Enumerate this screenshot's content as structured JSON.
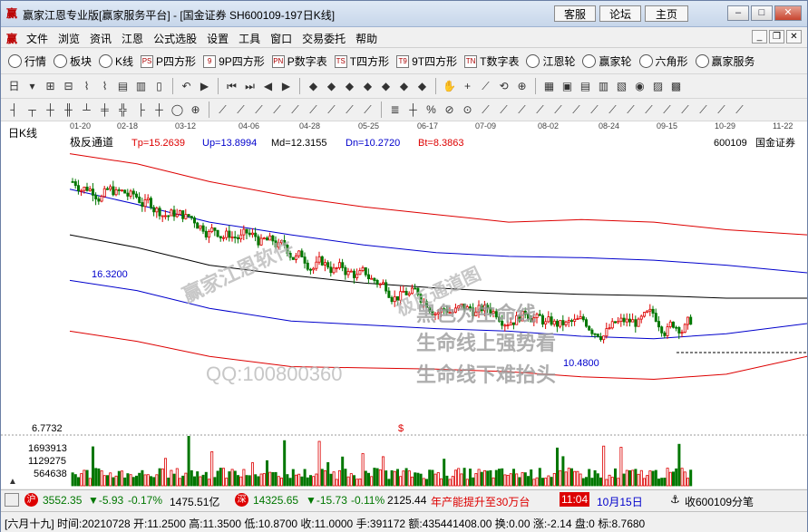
{
  "window": {
    "title": "赢家江恩专业版[赢家服务平台] - [国金证券  SH600109-197日K线]",
    "app_icon": "赢",
    "buttons": [
      "客服",
      "论坛",
      "主页"
    ]
  },
  "menu": {
    "items": [
      "文件",
      "浏览",
      "资讯",
      "江恩",
      "公式选股",
      "设置",
      "工具",
      "窗口",
      "交易委托",
      "帮助"
    ]
  },
  "toolbar1": {
    "items": [
      {
        "label": "行情",
        "icon": "grid-icon"
      },
      {
        "label": "板块",
        "icon": "blocks-icon"
      },
      {
        "label": "K线",
        "icon": "candlestick-icon"
      },
      {
        "label": "P四方形",
        "icon": "PS"
      },
      {
        "label": "9P四方形",
        "icon": "9"
      },
      {
        "label": "P数字表",
        "icon": "PN"
      },
      {
        "label": "T四方形",
        "icon": "TS"
      },
      {
        "label": "9T四方形",
        "icon": "T9"
      },
      {
        "label": "T数字表",
        "icon": "TN"
      },
      {
        "label": "江恩轮",
        "icon": "wheel-icon"
      },
      {
        "label": "赢家轮",
        "icon": "wheel2-icon"
      },
      {
        "label": "六角形",
        "icon": "hexagon-icon"
      },
      {
        "label": "赢家服务",
        "icon": "dollar-icon"
      }
    ]
  },
  "chart_panel": {
    "period_label": "日K线",
    "indicator_name": "极反通道",
    "readouts": [
      {
        "label": "Tp=15.2639",
        "color": "#dd0000"
      },
      {
        "label": "Up=13.8994",
        "color": "#0000cc"
      },
      {
        "label": "Md=12.3155",
        "color": "#000000"
      },
      {
        "label": "Dn=10.2720",
        "color": "#0000cc"
      },
      {
        "label": "Bt=8.3863",
        "color": "#dd0000"
      }
    ],
    "stock_code": "600109",
    "stock_name": "国金证券",
    "date_ticks": [
      "01-20",
      "02-18",
      "03-12",
      "04-06",
      "04-28",
      "05-25",
      "06-17",
      "07-09",
      "08-02",
      "08-24",
      "09-15",
      "10-29",
      "11-22"
    ],
    "high_label": "16.3200",
    "low_label": "10.4800",
    "price_axis_label": "6.7732",
    "dollar_mark": "$",
    "volume_labels": [
      "1693913",
      "1129275",
      "564638"
    ],
    "watermarks": [
      "极反通道图",
      "赢家江恩软件",
      "黑色为生命线",
      "生命线上强势看",
      "生命线下难抬头",
      "QQ:100800360"
    ]
  },
  "chart_data": {
    "type": "candlestick",
    "title": "极反通道",
    "x_start": "01-20",
    "x_end": "11-22",
    "ylim": [
      6.7732,
      17.5
    ],
    "series": [
      {
        "name": "Tp",
        "color": "#dd0000",
        "last_value": 15.2639
      },
      {
        "name": "Up",
        "color": "#0000cc",
        "last_value": 13.8994
      },
      {
        "name": "Md",
        "color": "#000000",
        "last_value": 12.3155
      },
      {
        "name": "Dn",
        "color": "#0000cc",
        "last_value": 10.272
      },
      {
        "name": "Bt",
        "color": "#dd0000",
        "last_value": 8.3863
      }
    ],
    "price_high": 16.32,
    "price_low": 10.48,
    "volume_axis": [
      564638,
      1129275,
      1693913
    ]
  },
  "statusbar": {
    "sh_badge": "沪",
    "sh_index": "3552.35",
    "sh_change": "▼-5.93",
    "sh_pct": "-0.17%",
    "sh_amount": "1475.51亿",
    "sz_badge": "深",
    "sz_index": "14325.65",
    "sz_change": "▼-15.73",
    "sz_pct": "-0.11%",
    "sz_amount": "2125.44",
    "ticker_text": "年产能提升至30万台",
    "time": "11:04",
    "date": "10月15日",
    "collect_text": "收600109分笔"
  },
  "infobar": {
    "text": "[六月十九] 时间:20210728 开:11.2500 高:11.3500 低:10.8700 收:11.0000 手:391172 额:435441408.00 换:0.00 涨:-2.14 盘:0 标:8.7680"
  },
  "colors": {
    "up_candle": "#dd0000",
    "down_candle": "#007700",
    "channel_outer": "#dd0000",
    "channel_inner": "#0000cc",
    "life_line": "#000000"
  }
}
